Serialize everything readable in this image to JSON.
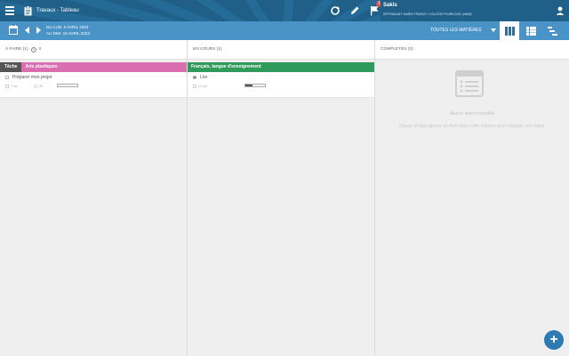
{
  "header": {
    "title": "Travaux - Tableau",
    "user_name": "Sakis",
    "user_role": "RÉPONDANT: MARIE-FRANCE / COLLÈGE PLURICOSC (MAW)",
    "notification_count": "1"
  },
  "datebar": {
    "date_from": "DU LUN. 3 AVRIL 2023",
    "date_to": "AU DIM. 16 AVRIL 2023",
    "subject_filter": "TOUTES LES MATIÈRES"
  },
  "columns": {
    "todo": {
      "label": "À FAIRE (1)",
      "overdue": "0",
      "card": {
        "type_tag": "Tâche",
        "subject": "Arts plastiques",
        "title": "Préparer mon projet",
        "duration": "7 av.",
        "effort": "4h",
        "progress": 0
      }
    },
    "in_progress": {
      "label": "EN COURS (1)",
      "card": {
        "subject": "Français, langue d'enseignement",
        "title": "Lire",
        "duration": "21 av.",
        "progress": 0.35
      }
    },
    "done": {
      "label": "COMPLÉTÉS (0)",
      "empty_title": "Aucun item complété",
      "empty_hint": "Cliquer et faire glisser un item dans cette colonne pour changer son statut."
    }
  },
  "colors": {
    "topbar": "#1f5f88",
    "datebar": "#4a93c6",
    "subject_arts": "#d96fb0",
    "subject_french": "#2f9a5a",
    "fab": "#2e7ab3"
  },
  "fab_label": "+"
}
